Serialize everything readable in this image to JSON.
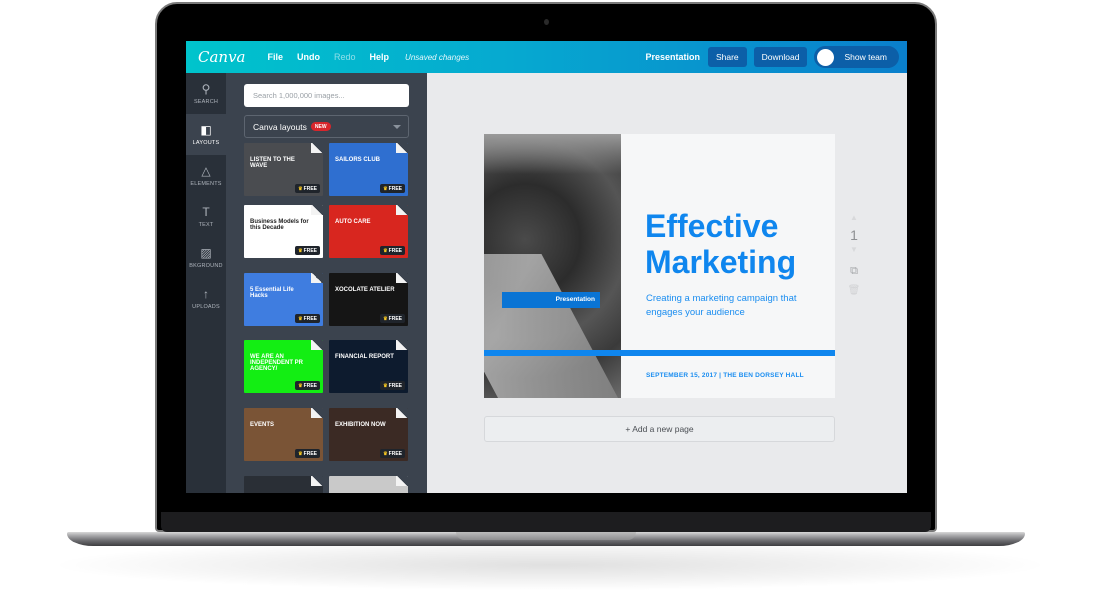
{
  "app": {
    "logo": "Canva",
    "menu": [
      {
        "label": "File",
        "enabled": true
      },
      {
        "label": "Undo",
        "enabled": true
      },
      {
        "label": "Redo",
        "enabled": false
      },
      {
        "label": "Help",
        "enabled": true
      }
    ],
    "status": "Unsaved changes",
    "document_type": "Presentation",
    "share_label": "Share",
    "download_label": "Download",
    "show_team_label": "Show team",
    "brand_colors": {
      "topbar_start": "#00c4cc",
      "topbar_end": "#0a7fcc",
      "accent": "#0f86ee"
    }
  },
  "sidebar": {
    "items": [
      {
        "label": "SEARCH",
        "icon": "search-icon",
        "glyph": "⚲",
        "active": false
      },
      {
        "label": "LAYOUTS",
        "icon": "layouts-icon",
        "glyph": "◧",
        "active": true
      },
      {
        "label": "ELEMENTS",
        "icon": "elements-icon",
        "glyph": "△",
        "active": false
      },
      {
        "label": "TEXT",
        "icon": "text-icon",
        "glyph": "T",
        "active": false
      },
      {
        "label": "BKGROUND",
        "icon": "background-icon",
        "glyph": "▨",
        "active": false
      },
      {
        "label": "UPLOADS",
        "icon": "uploads-icon",
        "glyph": "↑",
        "active": false
      }
    ]
  },
  "panel": {
    "search_placeholder": "Search 1,000,000 images...",
    "dropdown_value": "Canva layouts",
    "dropdown_badge": "NEW",
    "free_label": "FREE",
    "templates": [
      {
        "title": "LISTEN TO THE WAVE",
        "bg": "#4a4c50"
      },
      {
        "title": "SAILORS CLUB",
        "bg": "#2f6fd0"
      },
      {
        "title": "Business Models for this Decade",
        "bg": "#ffffff"
      },
      {
        "title": "AUTO CARE",
        "bg": "#d8261f"
      },
      {
        "title": "5 Essential Life Hacks",
        "bg": "#3f7de0"
      },
      {
        "title": "XOCOLATE ATELIER",
        "bg": "#151515"
      },
      {
        "title": "WE ARE AN INDEPENDENT PR AGENCY/",
        "bg": "#13ee13"
      },
      {
        "title": "FINANCIAL REPORT",
        "bg": "#0d1b2e"
      },
      {
        "title": "EVENTS",
        "bg": "#7a5436"
      },
      {
        "title": "EXHIBITION NOW",
        "bg": "#3b2a24"
      },
      {
        "title": "",
        "bg": "#2a2f36"
      },
      {
        "title": "",
        "bg": "#c9c9c9"
      }
    ]
  },
  "slide": {
    "tag": "Presentation",
    "headline_line1": "Effective",
    "headline_line2": "Marketing",
    "subline": "Creating a marketing campaign that engages your audience",
    "footer": "SEPTEMBER 15, 2017  |  THE BEN DORSEY HALL"
  },
  "page_controls": {
    "page_number": "1",
    "up_icon": "▲",
    "down_icon": "▼",
    "copy_icon": "⧉",
    "trash_icon": "🗑"
  },
  "add_page_label": "+ Add a new page"
}
